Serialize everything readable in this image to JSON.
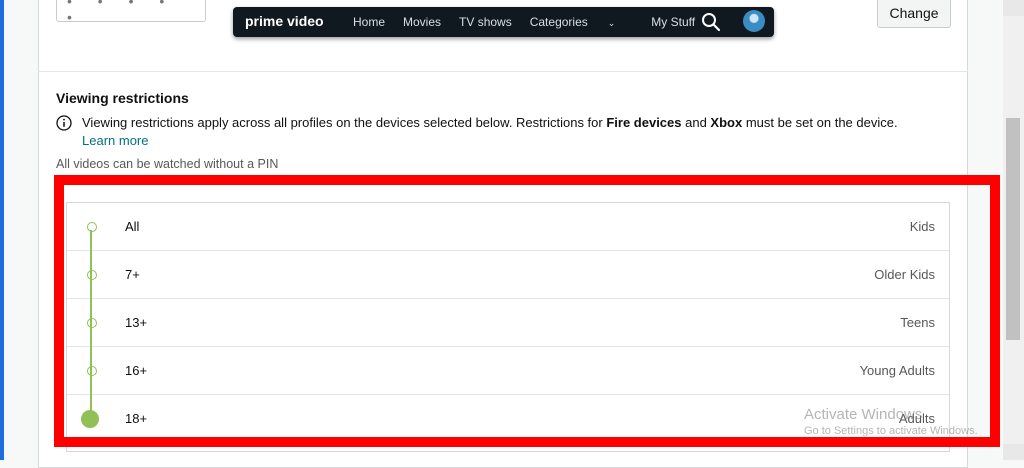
{
  "account": {
    "pin_mask": "• • • • •",
    "change_label": "Change"
  },
  "prime_video_bar": {
    "logo": "prime video",
    "nav": [
      "Home",
      "Movies",
      "TV shows",
      "Categories",
      "My Stuff"
    ],
    "search_icon": "search-icon",
    "avatar_icon": "profile-avatar"
  },
  "viewing_restrictions": {
    "title": "Viewing restrictions",
    "info_prefix": "Viewing restrictions apply across all profiles on the devices selected below. Restrictions for ",
    "info_bold1": "Fire devices",
    "info_mid": " and ",
    "info_bold2": "Xbox",
    "info_suffix": " must be set on the device.",
    "learn_more": "Learn more",
    "pin_note": "All videos can be watched without a PIN",
    "levels": [
      {
        "age": "All",
        "category": "Kids",
        "selected": false
      },
      {
        "age": "7+",
        "category": "Older Kids",
        "selected": false
      },
      {
        "age": "13+",
        "category": "Teens",
        "selected": false
      },
      {
        "age": "16+",
        "category": "Young Adults",
        "selected": false
      },
      {
        "age": "18+",
        "category": "Adults",
        "selected": true
      }
    ]
  },
  "windows_watermark": {
    "line1": "Activate Windows",
    "line2": "Go to Settings to activate Windows."
  },
  "colors": {
    "accent_green": "#8fc157",
    "highlight_red": "#ff0000",
    "link": "#007185",
    "bar": "#111920"
  }
}
